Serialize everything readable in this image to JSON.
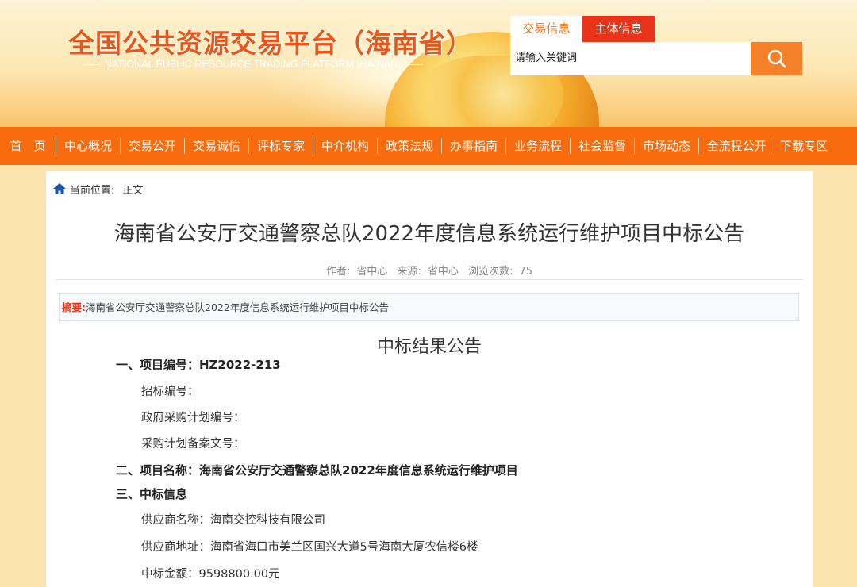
{
  "header": {
    "site_title": "全国公共资源交易平台（海南省）",
    "site_subtitle": "NATIONAL PUBLIC RESOURCE TRADING PLATFORM (HAINAN)",
    "tabs": [
      {
        "label": "交易信息",
        "active": true
      },
      {
        "label": "主体信息",
        "active": false
      }
    ],
    "search": {
      "value": "请输入关键词"
    },
    "search_button_icon": "search-icon"
  },
  "nav": {
    "items": [
      "首　页",
      "中心概况",
      "交易公开",
      "交易诚信",
      "评标专家",
      "中介机构",
      "政策法规",
      "办事指南",
      "业务流程",
      "社会监督",
      "市场动态",
      "全流程公开",
      "下载专区"
    ]
  },
  "breadcrumb": {
    "prefix": "当前位置:",
    "current": "正文"
  },
  "article": {
    "title": "海南省公安厅交通警察总队2022年度信息系统运行维护项目中标公告",
    "meta": {
      "author_label": "作者:",
      "author": "省中心",
      "source_label": "来源:",
      "source": "省中心",
      "views_label": "浏览次数:",
      "views": "75"
    },
    "abstract_label": "摘要:",
    "abstract": "海南省公安厅交通警察总队2022年度信息系统运行维护项目中标公告",
    "section_title": "中标结果公告",
    "lines": [
      {
        "kind": "h",
        "text": "一、项目编号：HZ2022-213"
      },
      {
        "kind": "s",
        "text": "招标编号："
      },
      {
        "kind": "s",
        "text": "政府采购计划编号："
      },
      {
        "kind": "s",
        "text": "采购计划备案文号："
      },
      {
        "kind": "h",
        "text": "二、项目名称：海南省公安厅交通警察总队2022年度信息系统运行维护项目"
      },
      {
        "kind": "h",
        "text": "三、中标信息"
      },
      {
        "kind": "s",
        "text": "供应商名称：海南交控科技有限公司"
      },
      {
        "kind": "s",
        "text": "供应商地址：海南省海口市美兰区国兴大道5号海南大厦农信楼6楼"
      },
      {
        "kind": "s",
        "text": "中标金额：9598800.00元"
      }
    ]
  },
  "colors": {
    "nav_bg": "#f86b0e",
    "accent_red": "#e8351a",
    "title_orange": "#e9561a"
  }
}
